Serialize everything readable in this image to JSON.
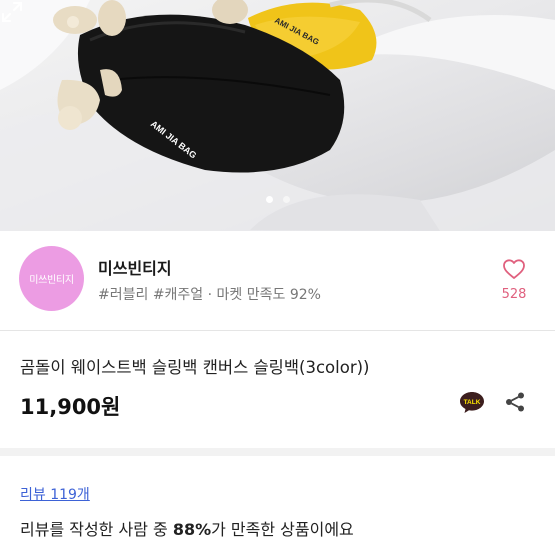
{
  "photo": {
    "bag_black_text": "AMI JIA BAG",
    "bag_yellow_text": "AMI JIA BAG",
    "slide_count": 2,
    "active_slide": 1,
    "expand_icon": "expand-icon"
  },
  "shop": {
    "avatar_text": "미쓰빈티지",
    "name": "미쓰빈티지",
    "tags": "#러블리 #캐주얼 · 마켓 만족도 92%",
    "like_count": "528",
    "heart_icon": "heart-outline-icon"
  },
  "product": {
    "title": "곰돌이 웨이스트백 슬링백 캔버스 슬링백(3color))",
    "price": "11,900원",
    "talk_label": "TALK",
    "share_icon": "share-icon"
  },
  "review": {
    "link_label": "리뷰 119개",
    "summary_before": "리뷰를 작성한 사람 중 ",
    "summary_percent": "88%",
    "summary_after": "가 만족한 상품이에요"
  },
  "colors": {
    "accent_pink": "#e0607e",
    "avatar_bg": "#ec9ce3",
    "link_blue": "#3d62d6",
    "kakao_dark": "#3c1e1e",
    "kakao_yellow": "#fee500"
  }
}
